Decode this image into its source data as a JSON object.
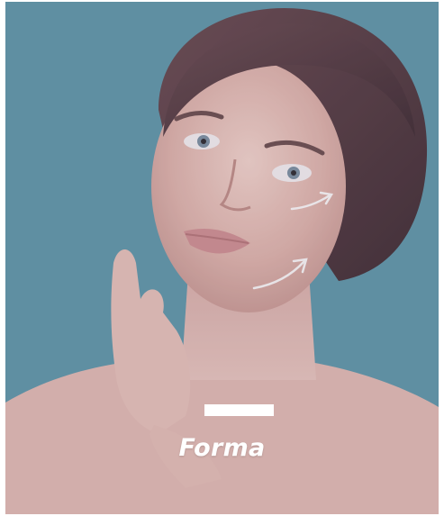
{
  "card": {
    "title": "Forma",
    "background_color": "#5f97a8",
    "accent_bar_color": "#ffffff"
  },
  "image": {
    "description_icon": "woman-face-photo",
    "arrows": [
      "lift-arrow-upper",
      "lift-arrow-lower"
    ]
  }
}
